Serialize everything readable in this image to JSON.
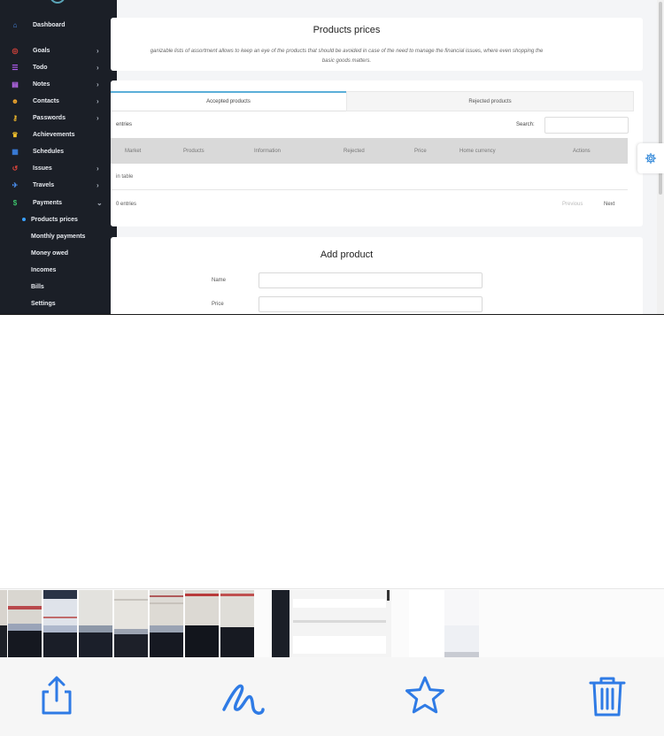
{
  "sidebar": {
    "items": [
      {
        "label": "Dashboard",
        "icon": "home-icon"
      },
      {
        "label": "Goals",
        "icon": "target-icon"
      },
      {
        "label": "Todo",
        "icon": "list-icon"
      },
      {
        "label": "Notes",
        "icon": "note-icon"
      },
      {
        "label": "Contacts",
        "icon": "users-icon"
      },
      {
        "label": "Passwords",
        "icon": "key-icon"
      },
      {
        "label": "Achievements",
        "icon": "trophy-icon"
      },
      {
        "label": "Schedules",
        "icon": "calendar-icon"
      },
      {
        "label": "Issues",
        "icon": "history-icon"
      },
      {
        "label": "Travels",
        "icon": "plane-icon"
      },
      {
        "label": "Payments",
        "icon": "dollar-icon"
      }
    ],
    "sub_items": [
      "Products prices",
      "Monthly payments",
      "Money owed",
      "Incomes",
      "Bills",
      "Settings"
    ]
  },
  "header_card": {
    "title": "Products prices",
    "description_line1": "ganizable lists of assortment allows to keep an eye of the products that should be avoided in case of the need to manage the financial issues, where even shopping the",
    "description_line2": "basic goods matters."
  },
  "table_card": {
    "tabs": [
      "Accepted products",
      "Rejected products"
    ],
    "entries_label": "entries",
    "search_label": "Search:",
    "columns": [
      "Market",
      "Products",
      "Information",
      "Rejected",
      "Price",
      "Home currency",
      "Actions"
    ],
    "empty_text": "in table",
    "showing_text": "0 entries",
    "prev_label": "Previous",
    "next_label": "Next"
  },
  "add_card": {
    "title": "Add product",
    "fields": [
      "Name",
      "Price"
    ]
  },
  "colors": {
    "sidebar_bg": "#1b1f27",
    "accent": "#3b82f6",
    "active_tab_border": "#5aaed8"
  },
  "toolbar": {
    "buttons": [
      "share-icon",
      "markup-icon",
      "favorite-icon",
      "trash-icon"
    ]
  }
}
